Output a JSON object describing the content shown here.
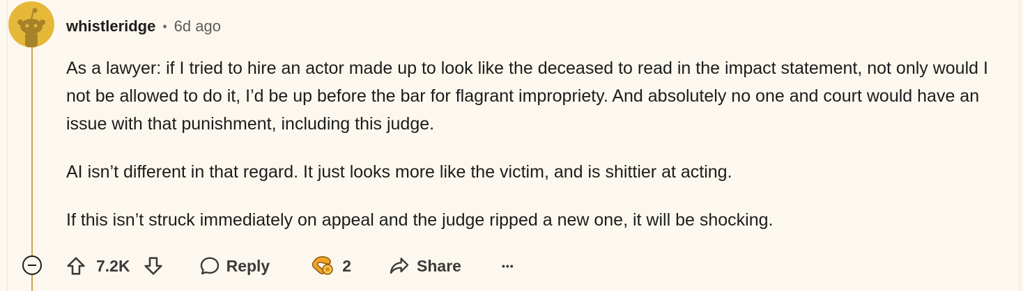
{
  "comment": {
    "username": "whistleridge",
    "separator": "•",
    "time": "6d ago",
    "paragraphs": [
      "As a lawyer: if I tried to hire an actor made up to look like the deceased to read in the impact statement, not only would I not be allowed to do it, I’d be up before the bar for flagrant impropriety. And absolutely no one and court would have an issue with that punishment, including this judge.",
      "AI isn’t different in that regard. It just looks more like the victim, and is shittier at acting.",
      "If this isn’t struck immediately on appeal and the judge ripped a new one, it will be shocking."
    ]
  },
  "actions": {
    "vote_count": "7.2K",
    "reply_label": "Reply",
    "award_count": "2",
    "share_label": "Share",
    "more_label": "•••"
  },
  "colors": {
    "background": "#fdf8ef",
    "thread_line": "#c7a559",
    "avatar": "#e5b83a"
  }
}
